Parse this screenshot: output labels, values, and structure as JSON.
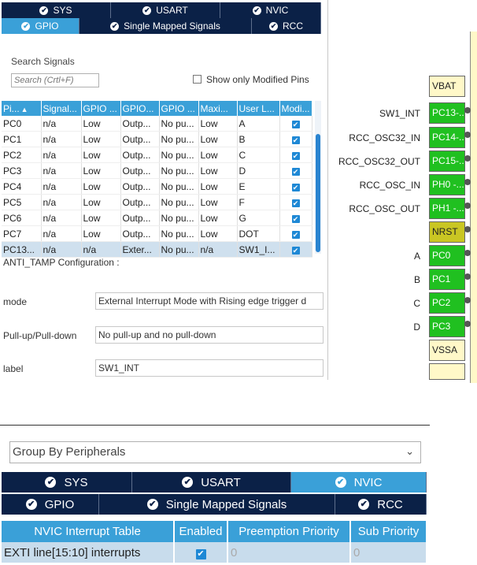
{
  "top_tabs": {
    "row1": [
      {
        "label": "SYS",
        "active": false
      },
      {
        "label": "USART",
        "active": false
      },
      {
        "label": "NVIC",
        "active": false
      }
    ],
    "row2": [
      {
        "label": "GPIO",
        "active": true
      },
      {
        "label": "Single Mapped Signals",
        "active": false
      },
      {
        "label": "RCC",
        "active": false
      }
    ]
  },
  "search": {
    "label": "Search Signals",
    "placeholder": "Search (Crtl+F)",
    "show_modified_label": "Show only Modified Pins"
  },
  "signals_table": {
    "headers": [
      "Pi...",
      "Signal...",
      "GPIO ...",
      "GPIO...",
      "GPIO ...",
      "Maxi...",
      "User L...",
      "Modi..."
    ],
    "rows": [
      [
        "PC0",
        "n/a",
        "Low",
        "Outp...",
        "No pu...",
        "Low",
        "A"
      ],
      [
        "PC1",
        "n/a",
        "Low",
        "Outp...",
        "No pu...",
        "Low",
        "B"
      ],
      [
        "PC2",
        "n/a",
        "Low",
        "Outp...",
        "No pu...",
        "Low",
        "C"
      ],
      [
        "PC3",
        "n/a",
        "Low",
        "Outp...",
        "No pu...",
        "Low",
        "D"
      ],
      [
        "PC4",
        "n/a",
        "Low",
        "Outp...",
        "No pu...",
        "Low",
        "E"
      ],
      [
        "PC5",
        "n/a",
        "Low",
        "Outp...",
        "No pu...",
        "Low",
        "F"
      ],
      [
        "PC6",
        "n/a",
        "Low",
        "Outp...",
        "No pu...",
        "Low",
        "G"
      ],
      [
        "PC7",
        "n/a",
        "Low",
        "Outp...",
        "No pu...",
        "Low",
        "DOT"
      ],
      [
        "PC13...",
        "n/a",
        "n/a",
        "Exter...",
        "No pu...",
        "n/a",
        "SW1_I..."
      ]
    ],
    "selected_row": 8
  },
  "config": {
    "section_title": "ANTI_TAMP Configuration :",
    "mode_label": "mode",
    "mode_value": "External Interrupt Mode with Rising edge trigger d",
    "pull_label": "Pull-up/Pull-down",
    "pull_value": "No pull-up and no pull-down",
    "user_label": "label",
    "user_value": "SW1_INT"
  },
  "chip": {
    "pins": [
      {
        "name": "VBAT",
        "label": "",
        "color": "pale"
      },
      {
        "name": "PC13-...",
        "label": "SW1_INT",
        "color": "green"
      },
      {
        "name": "PC14-...",
        "label": "RCC_OSC32_IN",
        "color": "green"
      },
      {
        "name": "PC15-...",
        "label": "RCC_OSC32_OUT",
        "color": "green"
      },
      {
        "name": "PH0 -...",
        "label": "RCC_OSC_IN",
        "color": "green"
      },
      {
        "name": "PH1 -...",
        "label": "RCC_OSC_OUT",
        "color": "green"
      },
      {
        "name": "NRST",
        "label": "",
        "color": "olive"
      },
      {
        "name": "PC0",
        "label": "A",
        "color": "green"
      },
      {
        "name": "PC1",
        "label": "B",
        "color": "green"
      },
      {
        "name": "PC2",
        "label": "C",
        "color": "green"
      },
      {
        "name": "PC3",
        "label": "D",
        "color": "green"
      },
      {
        "name": "VSSA",
        "label": "",
        "color": "pale"
      }
    ],
    "colors": {
      "green": "#20c020",
      "pale": "#fff8c8",
      "olive": "#c9c623"
    }
  },
  "group_by": {
    "value": "Group By Peripherals"
  },
  "bottom_tabs": {
    "row1": [
      {
        "label": "SYS",
        "active": false
      },
      {
        "label": "USART",
        "active": false
      },
      {
        "label": "NVIC",
        "active": true
      }
    ],
    "row2": [
      {
        "label": "GPIO",
        "active": false
      },
      {
        "label": "Single Mapped Signals",
        "active": false
      },
      {
        "label": "RCC",
        "active": false
      }
    ]
  },
  "nvic_table": {
    "headers": [
      "NVIC Interrupt Table",
      "Enabled",
      "Preemption Priority",
      "Sub Priority"
    ],
    "rows": [
      {
        "name": "EXTI line[15:10] interrupts",
        "enabled": true,
        "preemption": "0",
        "sub": "0"
      }
    ]
  },
  "colors": {
    "tab_dark": "#0b2147",
    "tab_active": "#3aa0d8",
    "header_blue": "#3aa0d8"
  }
}
